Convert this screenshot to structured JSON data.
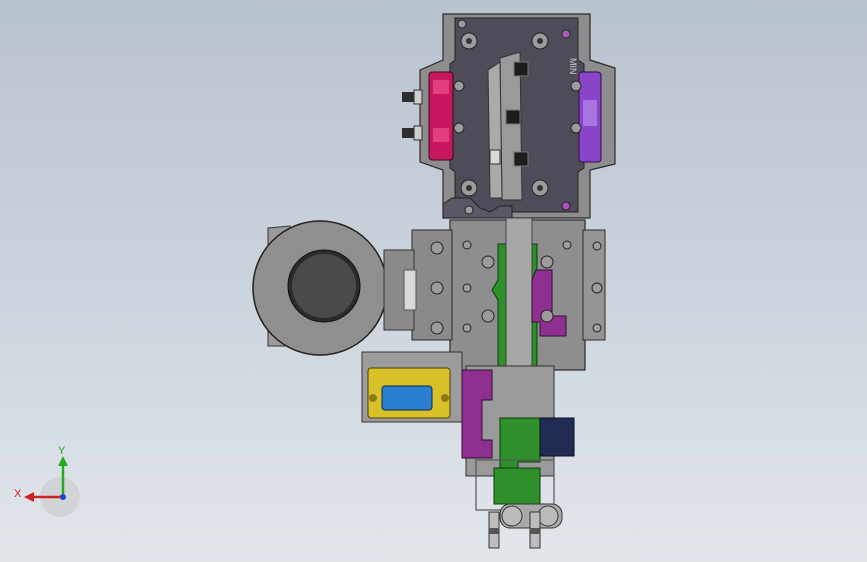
{
  "app": {
    "name": "",
    "view": "Front"
  },
  "model": {
    "engraving": "MIN",
    "colors": {
      "background_top": "#b9c3cf",
      "plate_gray": "#8a8a8a",
      "plate_dark": "#4e4b57",
      "magenta": "#c8175f",
      "purple": "#8a44c8",
      "green": "#2f8f2a",
      "yellow": "#d9c12a",
      "blue": "#2a7fd1",
      "navy": "#1f2b52",
      "violet": "#8f2f8f"
    }
  },
  "triad": {
    "x_label": "X",
    "y_label": "Y",
    "x_color": "#cc2222",
    "y_color": "#22aa22",
    "z_color": "#2244cc"
  }
}
